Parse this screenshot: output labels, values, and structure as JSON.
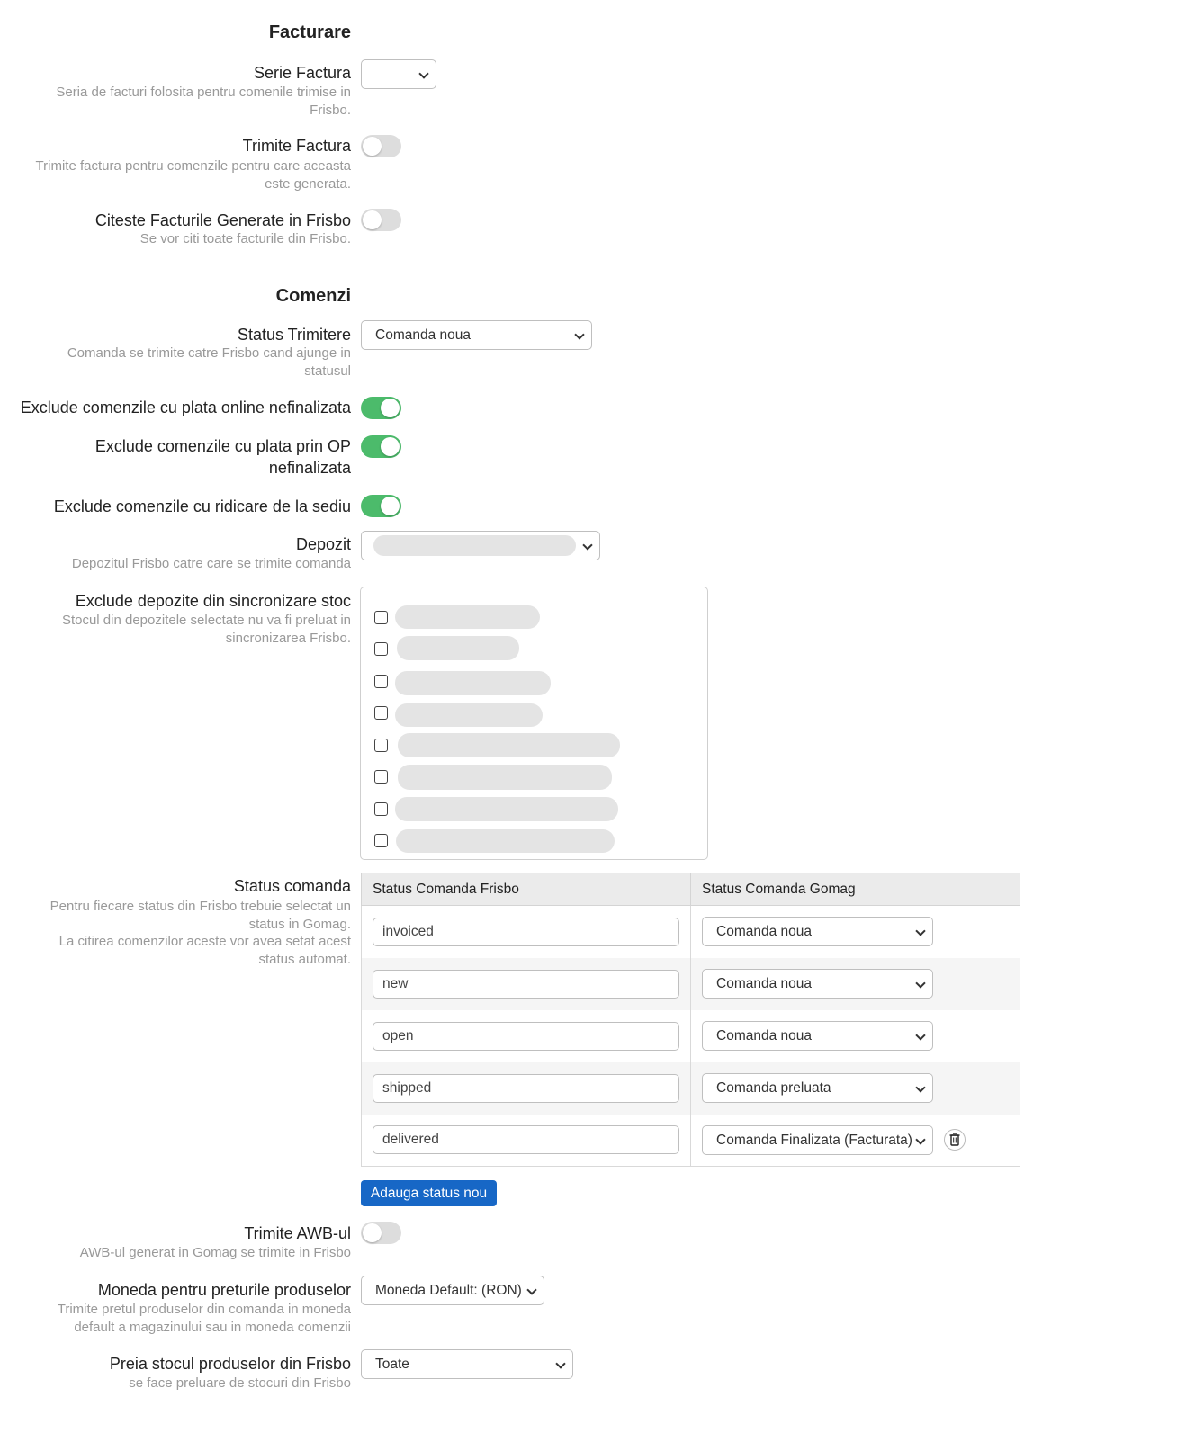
{
  "facturare": {
    "title": "Facturare",
    "serie_factura": {
      "label": "Serie Factura",
      "help": "Seria de facturi folosita pentru comenile trimise in Frisbo.",
      "value": ""
    },
    "trimite_factura": {
      "label": "Trimite Factura",
      "help": "Trimite factura pentru comenzile pentru care aceasta este generata.",
      "enabled": false
    },
    "citeste_facturi": {
      "label": "Citeste Facturile Generate in Frisbo",
      "help": "Se vor citi toate facturile din Frisbo.",
      "enabled": false
    }
  },
  "comenzi": {
    "title": "Comenzi",
    "status_trimitere": {
      "label": "Status Trimitere",
      "help": "Comanda se trimite catre Frisbo cand ajunge in statusul",
      "value": "Comanda noua"
    },
    "exclude_online": {
      "label": "Exclude comenzile cu plata online nefinalizata",
      "enabled": true
    },
    "exclude_op": {
      "label": "Exclude comenzile cu plata prin OP nefinalizata",
      "enabled": true
    },
    "exclude_sediu": {
      "label": "Exclude comenzile cu ridicare de la sediu",
      "enabled": true
    },
    "depozit": {
      "label": "Depozit",
      "help": "Depozitul Frisbo catre care se trimite comanda",
      "value": ""
    },
    "exclude_depozite": {
      "label": "Exclude depozite din sincronizare stoc",
      "help": "Stocul din depozitele selectate nu va fi preluat in sincronizarea Frisbo.",
      "options_count": 8
    },
    "status_comanda": {
      "label": "Status comanda",
      "help1": "Pentru fiecare status din Frisbo trebuie selectat un status in Gomag.",
      "help2": "La citirea comenzilor aceste vor avea setat acest status automat.",
      "col_frisbo": "Status Comanda Frisbo",
      "col_gomag": "Status Comanda Gomag",
      "rows": [
        {
          "frisbo": "invoiced",
          "gomag": "Comanda noua"
        },
        {
          "frisbo": "new",
          "gomag": "Comanda noua"
        },
        {
          "frisbo": "open",
          "gomag": "Comanda noua"
        },
        {
          "frisbo": "shipped",
          "gomag": "Comanda preluata"
        },
        {
          "frisbo": "delivered",
          "gomag": "Comanda Finalizata (Facturata)"
        }
      ],
      "add_button": "Adauga status nou"
    },
    "trimite_awb": {
      "label": "Trimite AWB-ul",
      "help": "AWB-ul generat in Gomag se trimite in Frisbo",
      "enabled": false
    },
    "moneda": {
      "label": "Moneda pentru preturile produselor",
      "help": "Trimite pretul produselor din comanda in moneda default a magazinului sau in moneda comenzii",
      "value": "Moneda Default: (RON)"
    },
    "preia_stoc": {
      "label": "Preia stocul produselor din Frisbo",
      "help": "se face preluare de stocuri din Frisbo",
      "value": "Toate"
    }
  },
  "colors": {
    "toggle_on": "#4cbb6b",
    "toggle_off": "#dddddd",
    "primary": "#1767c6"
  },
  "icons": {
    "select": "chevron-down-icon",
    "delete": "trash-icon"
  }
}
